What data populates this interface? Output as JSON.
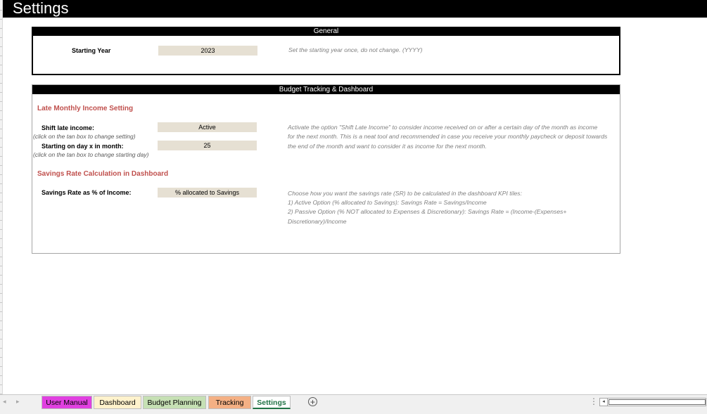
{
  "title": "Settings",
  "general": {
    "header": "General",
    "starting_year_label": "Starting Year",
    "starting_year_value": "2023",
    "starting_year_desc": "Set the starting year once, do not change. (YYYY)"
  },
  "budget": {
    "header": "Budget Tracking & Dashboard",
    "late_income_heading": "Late Monthly Income Setting",
    "shift_label": "Shift late income:",
    "shift_hint": "(click on the tan box to change setting)",
    "shift_value": "Active",
    "day_label": "Starting on day x in month:",
    "day_hint": "(click on the tan box to change starting day)",
    "day_value": "25",
    "late_desc_1": "Activate the option \"Shift Late Income\" to  consider income received on or after a certain day of the month as income",
    "late_desc_2": "for the next month. This is a neat tool and recommended in case you receive your monthly paycheck or deposit towards",
    "late_desc_3": "the end of the month and want to consider it as income for the next month.",
    "savings_heading": "Savings Rate Calculation in Dashboard",
    "sr_label": "Savings Rate as % of Income:",
    "sr_value": "% allocated to Savings",
    "sr_desc_1": "Choose how you want the savings rate (SR) to be calculated in the dashboard KPI tiles:",
    "sr_desc_2": "1) Active Option (% allocated to Savings): Savings Rate = Savings/Income",
    "sr_desc_3": "2) Passive Option (% NOT allocated to Expenses & Discretionary): Savings Rate = (Income-(Expenses+",
    "sr_desc_4": "Discretionary)/Income"
  },
  "tabs": [
    {
      "label": "User Manual",
      "color": "#e040e0"
    },
    {
      "label": "Dashboard",
      "color": "#fff2cc"
    },
    {
      "label": "Budget Planning",
      "color": "#c6e0b4"
    },
    {
      "label": "Tracking",
      "color": "#f4b084"
    },
    {
      "label": "Settings",
      "active": true
    }
  ],
  "colors": {
    "accent_heading": "#c0504d",
    "tan_box": "#e6e0d3",
    "active_tab": "#217346"
  },
  "icons": {
    "prev_sheet": "◂",
    "next_sheet": "▸",
    "add_sheet": "+",
    "more": "⋮",
    "scroll_left": "◂"
  }
}
